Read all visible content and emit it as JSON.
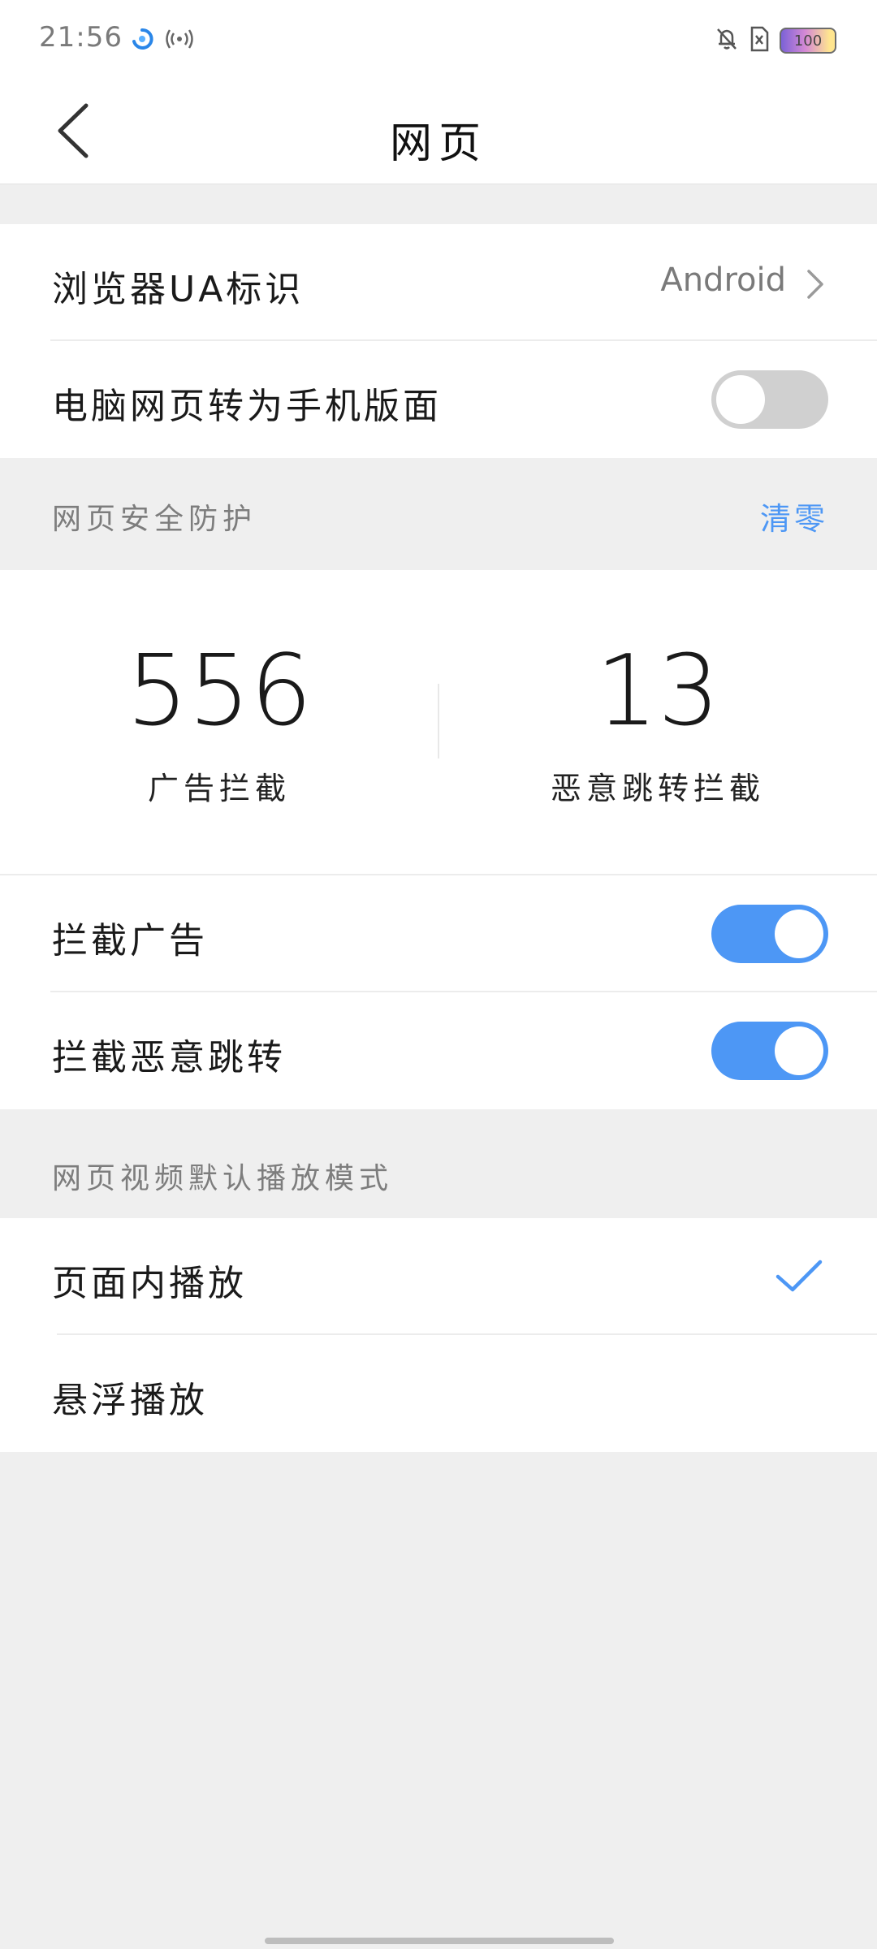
{
  "status_bar": {
    "time": "21:56",
    "battery_level": "100",
    "icons": [
      "sync-icon",
      "hotspot-icon",
      "notifications-off-icon",
      "sim-card-off-icon",
      "battery-icon"
    ]
  },
  "header": {
    "title": "网页"
  },
  "settings": {
    "ua": {
      "label": "浏览器UA标识",
      "value": "Android"
    },
    "desktop_to_mobile": {
      "label": "电脑网页转为手机版面",
      "enabled": false
    }
  },
  "security": {
    "section_title": "网页安全防护",
    "clear_label": "清零",
    "stats": [
      {
        "value": "556",
        "label": "广告拦截"
      },
      {
        "value": "13",
        "label": "恶意跳转拦截"
      }
    ],
    "block_ads": {
      "label": "拦截广告",
      "enabled": true
    },
    "block_redirects": {
      "label": "拦截恶意跳转",
      "enabled": true
    }
  },
  "video": {
    "section_title": "网页视频默认播放模式",
    "options": [
      {
        "label": "页面内播放",
        "selected": true
      },
      {
        "label": "悬浮播放",
        "selected": false
      }
    ]
  },
  "colors": {
    "accent": "#4d97f5",
    "toggle_off": "#d0d0d0",
    "background": "#efefef"
  }
}
